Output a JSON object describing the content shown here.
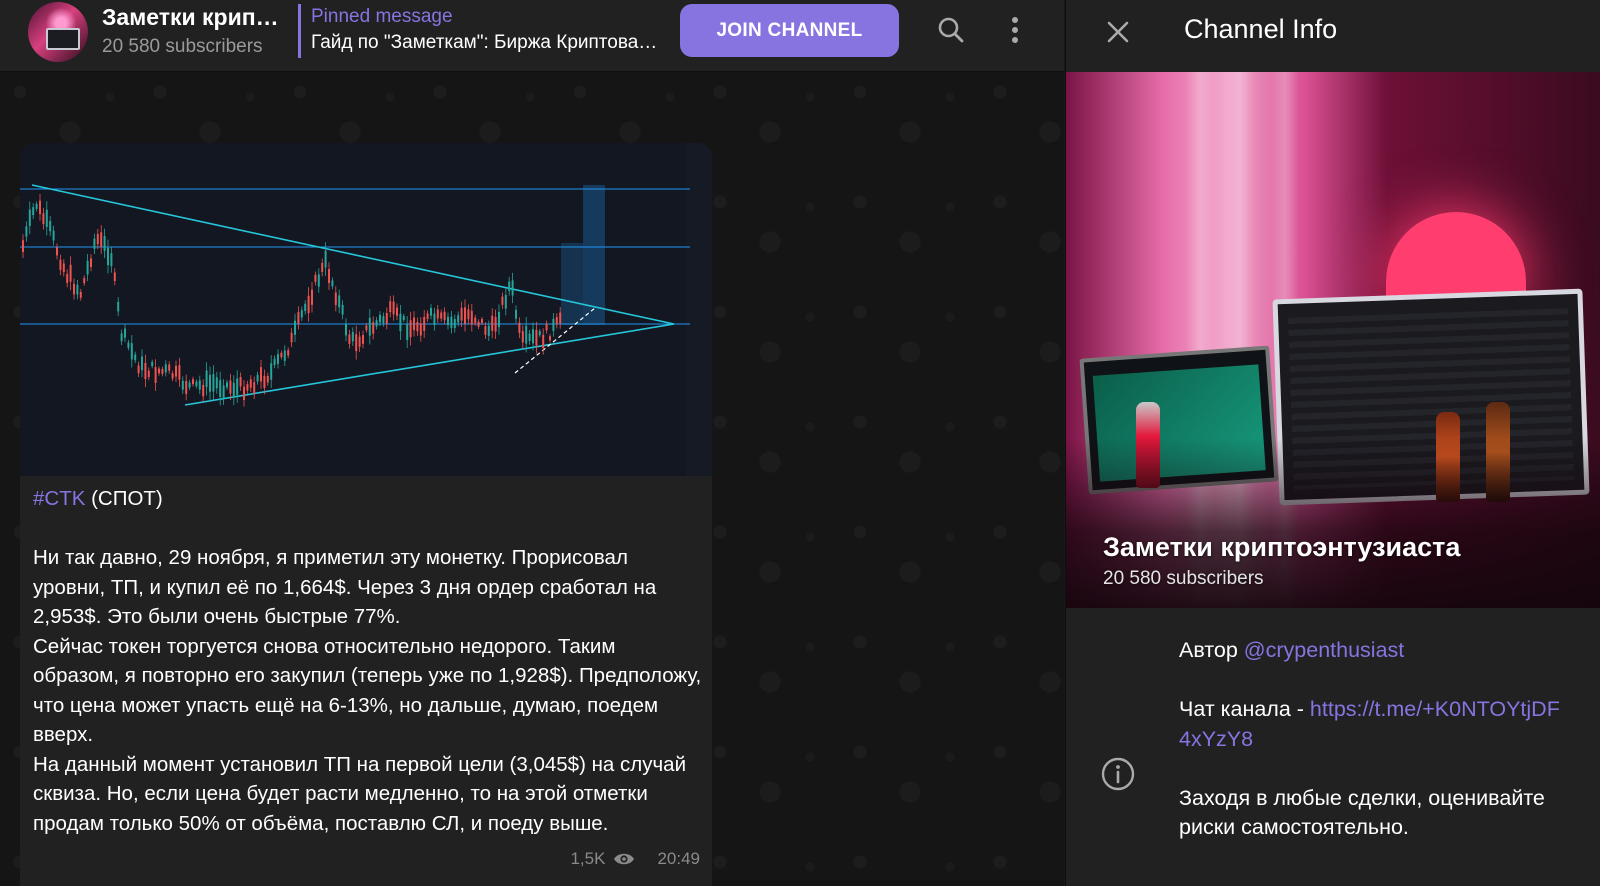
{
  "chat": {
    "header": {
      "title": "Заметки криптоэнтузиаста",
      "subscribers": "20 580 subscribers",
      "pinned_label": "Pinned message",
      "pinned_text": "Гайд по \"Заметкам\": Биржа Криптовалют",
      "join_label": "JOIN CHANNEL",
      "search_icon": "search-icon",
      "more_icon": "more-vertical-icon"
    },
    "post": {
      "hashtag": "#CTK",
      "tag_suffix": " (СПОТ)",
      "paragraph_1": "Ни так давно, 29 ноября, я приметил эту монетку. Прорисовал уровни, ТП, и купил её по 1,664$. Через 3 дня ордер сработал на 2,953$. Это были очень быстрые 77%.",
      "paragraph_2": "Сейчас токен торгуется снова относительно недорого. Таким образом, я повторно его закупил (теперь уже по 1,928$). Предположу, что цена может упасть ещё на 6-13%, но дальше, думаю, поедем вверх.",
      "paragraph_3": "На данный момент установил ТП на первой цели (3,045$) на случай сквиза. Но, если цена будет расти медленно, то на этой отметки продам только 50% от объёма, поставлю СЛ, и поеду выше.",
      "views": "1,5K",
      "time": "20:49",
      "views_icon": "eye-icon"
    }
  },
  "info": {
    "header_title": "Channel Info",
    "close_icon": "close-icon",
    "cover_title": "Заметки криптоэнтузиаста",
    "cover_subs": "20 580 subscribers",
    "author_label": "Автор ",
    "author_handle": "@crypenthusiast",
    "chat_label": "Чат канала - ",
    "chat_link": "https://t.me/+K0NTOYtjDF4xYzY8",
    "warning": "Заходя в любые сделки, оценивайте риски самостоятельно.",
    "info_icon": "info-icon"
  },
  "colors": {
    "accent": "#8774e1",
    "panel": "#212121",
    "background": "#161616",
    "chart_background": "#131722",
    "trendline": "#26c6da",
    "level_line": "#2196f3",
    "candle_up": "#26a69a",
    "candle_down": "#ef5350"
  }
}
